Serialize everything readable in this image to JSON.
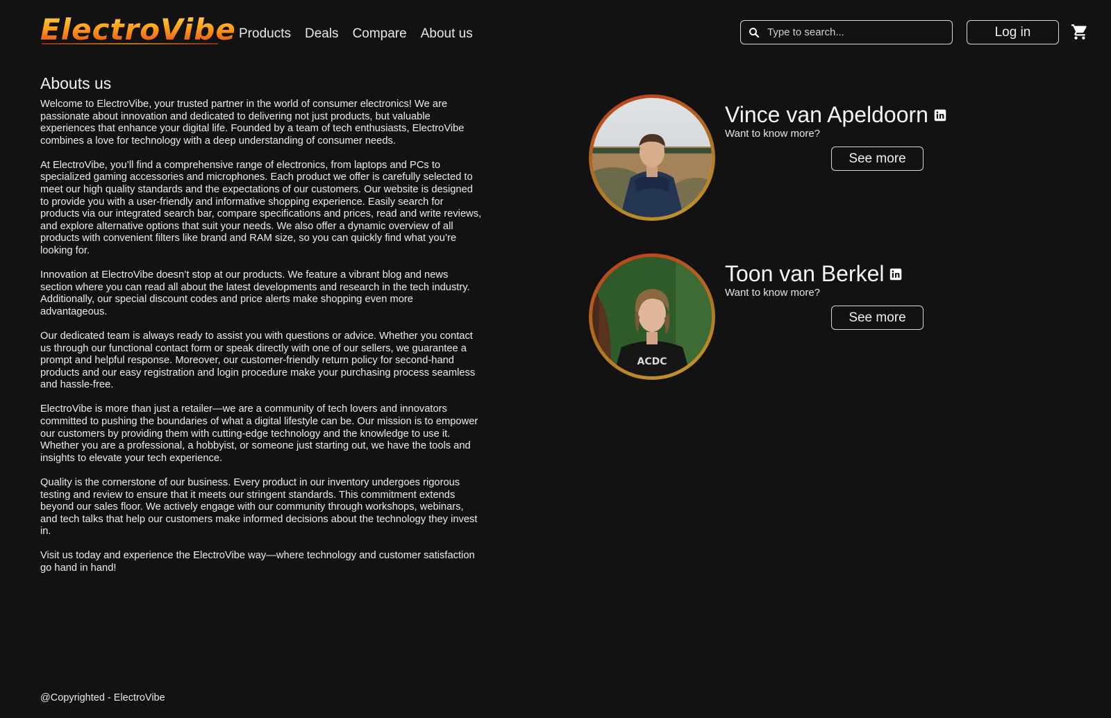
{
  "header": {
    "logo_text": "ElectroVibe",
    "nav": [
      {
        "label": "Products"
      },
      {
        "label": "Deals"
      },
      {
        "label": "Compare"
      },
      {
        "label": "About us"
      }
    ],
    "search": {
      "placeholder": "Type to search...",
      "value": ""
    },
    "login_label": "Log in"
  },
  "about": {
    "title": "Abouts us",
    "paragraphs": [
      "Welcome to ElectroVibe, your trusted partner in the world of consumer electronics! We are passionate about innovation and dedicated to delivering not just products, but valuable experiences that enhance your digital life. Founded by a team of tech enthusiasts, ElectroVibe combines a love for technology with a deep understanding of consumer needs.",
      "At ElectroVibe, you’ll find a comprehensive range of electronics, from laptops and PCs to specialized gaming accessories and microphones. Each product we offer is carefully selected to meet our high quality standards and the expectations of our customers. Our website is designed to provide you with a user-friendly and informative shopping experience. Easily search for products via our integrated search bar, compare specifications and prices, read and write reviews, and explore alternative options that suit your needs. We also offer a dynamic overview of all products with convenient filters like brand and RAM size, so you can quickly find what you’re looking for.",
      "Innovation at ElectroVibe doesn’t stop at our products. We feature a vibrant blog and news section where you can read all about the latest developments and research in the tech industry. Additionally, our special discount codes and price alerts make shopping even more advantageous.",
      "Our dedicated team is always ready to assist you with questions or advice. Whether you contact us through our functional contact form or speak directly with one of our sellers, we guarantee a prompt and helpful response. Moreover, our customer-friendly return policy for second-hand products and our easy registration and login procedure make your purchasing process seamless and hassle-free.",
      "ElectroVibe is more than just a retailer—we are a community of tech lovers and innovators committed to pushing the boundaries of what a digital lifestyle can be. Our mission is to empower our customers by providing them with cutting-edge technology and the knowledge to use it. Whether you are a professional, a hobbyist, or someone just starting out, we have the tools and insights to elevate your tech experience.",
      "Quality is the cornerstone of our business. Every product in our inventory undergoes rigorous testing and review to ensure that it meets our stringent standards. This commitment extends beyond our sales floor. We actively engage with our community through workshops, webinars, and tech talks that help our customers make informed decisions about the technology they invest in.",
      "Visit us today and experience the ElectroVibe way—where technology and customer satisfaction go hand in hand!"
    ]
  },
  "team": [
    {
      "name": "Vince van Apeldoorn",
      "subtitle": "Want to know more?",
      "button_label": "See more"
    },
    {
      "name": "Toon van Berkel",
      "subtitle": "Want to know more?",
      "button_label": "See more"
    }
  ],
  "footer": {
    "text": "@Copyrighted - ElectroVibe"
  },
  "colors": {
    "background": "#121212",
    "logo_gradient": [
      "#ffd54a",
      "#ff9f1a",
      "#e0411b"
    ],
    "avatar_ring": [
      "#c03a1a",
      "#c49a2a"
    ]
  },
  "icons": [
    "search-icon",
    "cart-icon",
    "linkedin-icon"
  ]
}
